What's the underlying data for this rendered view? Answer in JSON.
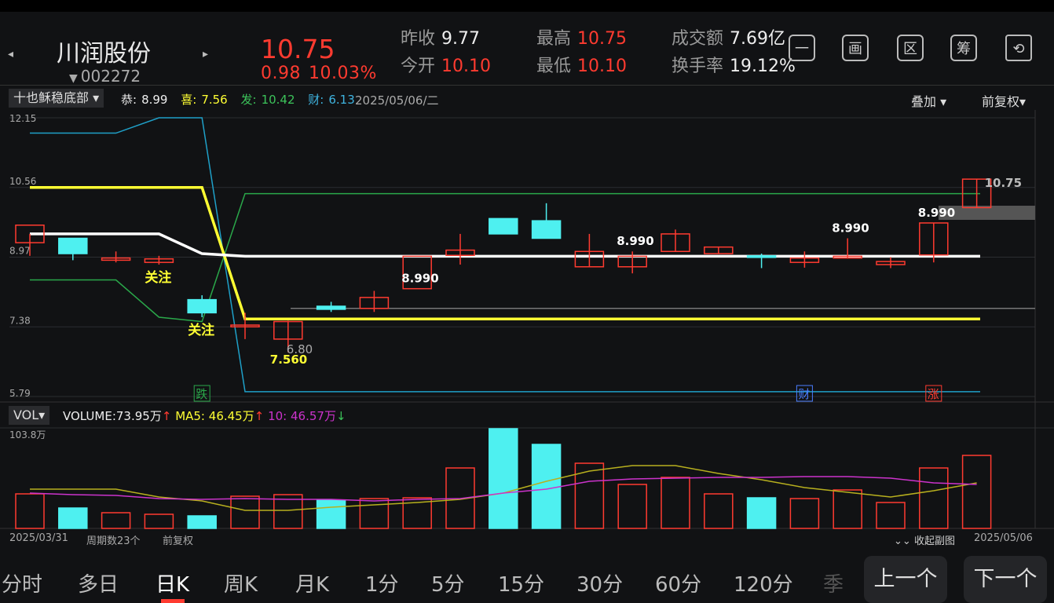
{
  "header": {
    "stock_name": "川润股份",
    "stock_code": "002272",
    "price": "10.75",
    "change_amount": "0.98",
    "change_percent": "10.03%",
    "prev_close_label": "昨收",
    "prev_close": "9.77",
    "open_label": "今开",
    "open": "10.10",
    "high_label": "最高",
    "high": "10.75",
    "low_label": "最低",
    "low": "10.10",
    "turnover_label": "成交额",
    "turnover": "7.69亿",
    "turnover_rate_label": "换手率",
    "turnover_rate": "19.12%"
  },
  "toolbar": {
    "icons": [
      "minus-box-icon",
      "painting-icon",
      "area-icon",
      "chips-icon",
      "rotate-screen-icon"
    ],
    "labels": [
      "一",
      "画",
      "区",
      "筹",
      "⟲"
    ]
  },
  "indicator": {
    "name": "十也稣稳底部",
    "gong_label": "恭:",
    "gong": "8.99",
    "xi_label": "喜:",
    "xi": "7.56",
    "fa_label": "发:",
    "fa": "10.42",
    "cai_label": "财:",
    "cai": "6.13",
    "date": "2025/05/06/二",
    "overlay_label": "叠加",
    "adjust_label": "前复权"
  },
  "volume": {
    "name": "VOL",
    "volume_label": "VOLUME:",
    "volume": "73.95万",
    "ma5_label": "MA5:",
    "ma5": "46.45万",
    "ma10_label": "10:",
    "ma10": "46.57万",
    "max_label": "103.8万"
  },
  "footer": {
    "start_date": "2025/03/31",
    "period_count": "周期数23个",
    "adjust": "前复权",
    "collapse_label": "收起副图",
    "end_date": "2025/05/06"
  },
  "tabs": [
    "分时",
    "多日",
    "日K",
    "周K",
    "月K",
    "1分",
    "5分",
    "15分",
    "30分",
    "60分",
    "120分",
    "季"
  ],
  "active_tab": "日K",
  "page_buttons": {
    "prev": "上一个",
    "next": "下一个"
  },
  "colors": {
    "up": "#ff3b30",
    "down": "#4ef0f0",
    "yellow": "#ffff33",
    "ma10": "#cc33cc",
    "green_line": "#2aa84a",
    "blue_line": "#1fa0c8"
  },
  "chart_data": {
    "type": "candlestick",
    "y_axis_labels": [
      "12.15",
      "10.56",
      "8.97",
      "7.38",
      "5.79"
    ],
    "ylim": [
      5.79,
      12.15
    ],
    "candles": [
      {
        "o": 9.3,
        "h": 9.5,
        "l": 9.0,
        "c": 9.7
      },
      {
        "o": 9.4,
        "h": 9.4,
        "l": 8.9,
        "c": 9.05
      },
      {
        "o": 8.9,
        "h": 9.1,
        "l": 8.85,
        "c": 8.95
      },
      {
        "o": 8.85,
        "h": 9.0,
        "l": 8.8,
        "c": 8.93
      },
      {
        "o": 8.0,
        "h": 8.1,
        "l": 7.6,
        "c": 7.7
      },
      {
        "o": 7.38,
        "h": 7.7,
        "l": 7.1,
        "c": 7.42
      },
      {
        "o": 7.1,
        "h": 7.52,
        "l": 6.8,
        "c": 7.5
      },
      {
        "o": 7.85,
        "h": 7.95,
        "l": 7.72,
        "c": 7.78
      },
      {
        "o": 7.8,
        "h": 8.2,
        "l": 7.72,
        "c": 8.05
      },
      {
        "o": 8.25,
        "h": 8.25,
        "l": 8.25,
        "c": 8.99
      },
      {
        "o": 9.01,
        "h": 9.5,
        "l": 8.8,
        "c": 9.13
      },
      {
        "o": 9.85,
        "h": 9.85,
        "l": 9.5,
        "c": 9.5
      },
      {
        "o": 9.8,
        "h": 10.2,
        "l": 9.4,
        "c": 9.4
      },
      {
        "o": 8.75,
        "h": 9.5,
        "l": 8.75,
        "c": 9.1
      },
      {
        "o": 8.75,
        "h": 9.1,
        "l": 8.6,
        "c": 8.99
      },
      {
        "o": 9.1,
        "h": 9.6,
        "l": 9.1,
        "c": 9.5
      },
      {
        "o": 9.05,
        "h": 9.2,
        "l": 9.05,
        "c": 9.2
      },
      {
        "o": 9.0,
        "h": 9.05,
        "l": 8.72,
        "c": 8.98
      },
      {
        "o": 8.85,
        "h": 9.1,
        "l": 8.73,
        "c": 8.95
      },
      {
        "o": 8.95,
        "h": 9.4,
        "l": 8.95,
        "c": 8.99
      },
      {
        "o": 8.8,
        "h": 8.97,
        "l": 8.72,
        "c": 8.87
      },
      {
        "o": 9.02,
        "h": 9.75,
        "l": 8.85,
        "c": 9.75
      },
      {
        "o": 10.1,
        "h": 10.75,
        "l": 10.1,
        "c": 10.75
      }
    ],
    "white_line": [
      9.5,
      9.5,
      9.5,
      9.5,
      9.05,
      8.99,
      8.99,
      8.99,
      8.99,
      8.99,
      8.99,
      8.99,
      8.99,
      8.99,
      8.99,
      8.99,
      8.99,
      8.99,
      8.99,
      8.99,
      8.99,
      8.99,
      8.99,
      8.99
    ],
    "yellow_line": [
      10.56,
      10.56,
      10.56,
      10.56,
      10.56,
      7.56,
      7.56,
      7.56,
      7.56,
      7.56,
      7.56,
      7.56,
      7.56,
      7.56,
      7.56,
      7.56,
      7.56,
      7.56,
      7.56,
      7.56,
      7.56,
      7.56,
      7.56,
      7.56
    ],
    "blue_line": [
      11.8,
      11.8,
      11.8,
      12.15,
      12.15,
      5.9,
      5.9,
      5.9,
      5.9,
      5.9,
      5.9,
      5.9,
      5.9,
      5.9,
      5.9,
      5.9,
      5.9,
      5.9,
      5.9,
      5.9,
      5.9,
      5.9,
      5.9,
      5.9
    ],
    "green_line": [
      8.45,
      8.45,
      8.45,
      7.6,
      7.5,
      10.42,
      10.42,
      10.42,
      10.42,
      10.42,
      10.42,
      10.42,
      10.42,
      10.42,
      10.42,
      10.42,
      10.42,
      10.42,
      10.42,
      10.42,
      10.42,
      10.42,
      10.42,
      10.42
    ],
    "gray_line_value": 7.8,
    "price_labels": [
      {
        "i": 9,
        "text": "8.990"
      },
      {
        "i": 14,
        "text": "8.990"
      },
      {
        "i": 19,
        "text": "8.990"
      },
      {
        "i": 21,
        "text": "8.990"
      },
      {
        "i": 22,
        "text": "10.75"
      }
    ],
    "low_labels": [
      {
        "i": 6,
        "text": "7.560"
      },
      {
        "i": 6,
        "text": "6.80"
      }
    ],
    "notes": [
      {
        "i": 3,
        "text": "关注"
      },
      {
        "i": 4,
        "text": "关注"
      }
    ],
    "event_markers": [
      {
        "i": 4,
        "text": "跌",
        "color": "#2aa84a"
      },
      {
        "i": 18,
        "text": "财",
        "color": "#4a7dff"
      },
      {
        "i": 21,
        "text": "涨",
        "color": "#ff3b30"
      }
    ],
    "volumes": [
      44,
      26,
      20,
      18,
      16,
      41,
      43,
      36,
      38,
      39,
      77,
      127,
      107,
      83,
      56,
      65,
      44,
      39,
      38,
      49,
      33,
      77,
      93
    ],
    "ma5": [
      50,
      50,
      50,
      40,
      35,
      23,
      23,
      27,
      30,
      33,
      37,
      45,
      60,
      73,
      80,
      80,
      70,
      62,
      52,
      46,
      40,
      48,
      58
    ],
    "ma10": [
      45,
      43,
      42,
      38,
      37,
      38,
      37,
      37,
      35,
      37,
      38,
      45,
      50,
      60,
      63,
      64,
      65,
      65,
      66,
      66,
      64,
      58,
      56
    ],
    "vol_max": 103.8
  }
}
